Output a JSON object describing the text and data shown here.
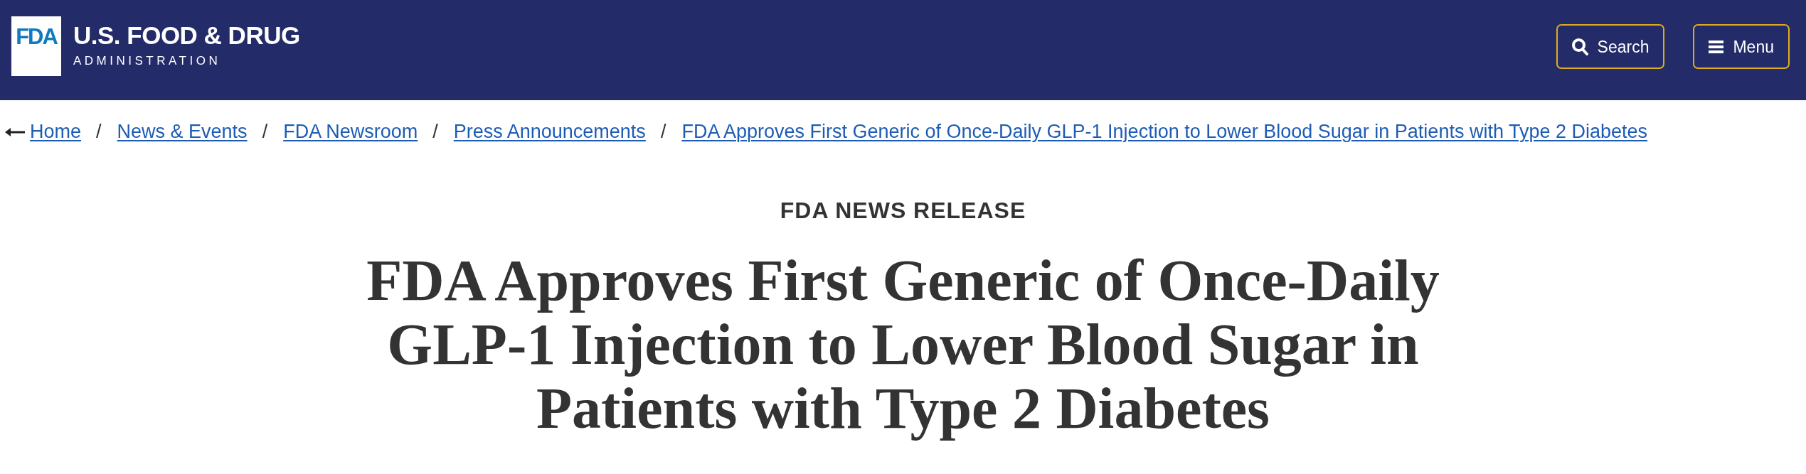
{
  "header": {
    "logo": {
      "mark": "FDA",
      "title": "U.S. FOOD & DRUG",
      "subtitle": "ADMINISTRATION"
    },
    "buttons": [
      {
        "kind": "search",
        "label": "Search"
      },
      {
        "kind": "menu",
        "label": "Menu"
      }
    ]
  },
  "breadcrumb": {
    "items": [
      "Home",
      "News & Events",
      "FDA Newsroom",
      "Press Announcements",
      "FDA Approves First Generic of Once-Daily GLP-1 Injection to Lower Blood Sugar in Patients with Type 2 Diabetes"
    ],
    "separators": [
      "/",
      "/",
      "/",
      "/"
    ]
  },
  "article": {
    "eyebrow": "FDA NEWS RELEASE",
    "title": "FDA Approves First Generic of Once-Daily GLP-1 Injection to Lower Blood Sugar in Patients with Type 2 Diabetes"
  }
}
